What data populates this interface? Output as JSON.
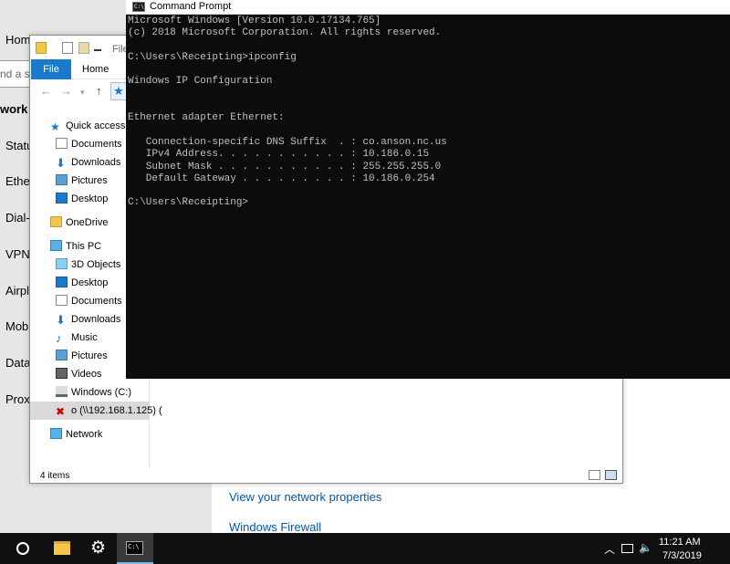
{
  "settings": {
    "home_label": "Home",
    "search_placeholder": "nd a s",
    "section_title": "work a",
    "nav_items": [
      "Status",
      "Ether",
      "Dial-u",
      "VPN",
      "Airpla",
      "Mobil",
      "Data",
      "Proxy"
    ],
    "links": [
      "View your network properties",
      "Windows Firewall"
    ]
  },
  "explorer": {
    "title_fragment": "File",
    "ribbon_tabs": [
      "File",
      "Home"
    ],
    "quick_access": {
      "label": "Quick access",
      "items": [
        "Documents",
        "Downloads",
        "Pictures",
        "Desktop"
      ]
    },
    "onedrive": "OneDrive",
    "this_pc": {
      "label": "This PC",
      "items": [
        "3D Objects",
        "Desktop",
        "Documents",
        "Downloads",
        "Music",
        "Pictures",
        "Videos",
        "Windows (C:)"
      ],
      "network_drive": "o (\\\\192.168.1.125) ("
    },
    "network": "Network",
    "status": "4 items"
  },
  "cmd": {
    "title": "Command Prompt",
    "output": "Microsoft Windows [Version 10.0.17134.765]\n(c) 2018 Microsoft Corporation. All rights reserved.\n\nC:\\Users\\Receipting>ipconfig\n\nWindows IP Configuration\n\n\nEthernet adapter Ethernet:\n\n   Connection-specific DNS Suffix  . : co.anson.nc.us\n   IPv4 Address. . . . . . . . . . . : 10.186.0.15\n   Subnet Mask . . . . . . . . . . . : 255.255.255.0\n   Default Gateway . . . . . . . . . : 10.186.0.254\n\nC:\\Users\\Receipting>"
  },
  "taskbar": {
    "time": "11:21 AM",
    "date": "7/3/2019",
    "icons": [
      "cortana-icon",
      "file-explorer-icon",
      "settings-gear-icon",
      "command-prompt-icon"
    ],
    "tray_icons": [
      "chevron-up-icon",
      "network-icon",
      "volume-icon",
      "notification-icon"
    ]
  },
  "colors": {
    "ribbon_file": "#1979ca",
    "cmd_bg": "#0c0c0c",
    "cmd_text": "#c0c0c0",
    "taskbar": "#101010",
    "link": "#0055b3"
  }
}
